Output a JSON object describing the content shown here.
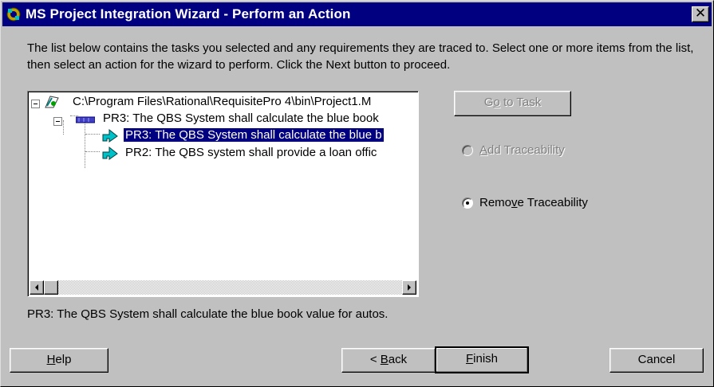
{
  "window": {
    "title": "MS Project Integration Wizard - Perform an Action",
    "close_symbol": "✕",
    "icon": "wizard-gear-icon"
  },
  "description": "The list below contains the tasks you selected and any requirements they are traced to. Select one or more items from the list, then select an action for the wizard to perform. Click the Next button to proceed.",
  "tree": {
    "root": {
      "label": "C:\\Program Files\\Rational\\RequisitePro 4\\bin\\Project1.M",
      "icon": "project-file-icon"
    },
    "task": {
      "label": "PR3: The QBS System shall calculate the blue book",
      "icon": "task-bar-icon"
    },
    "children": [
      {
        "label": "PR3: The QBS System shall calculate the blue b",
        "icon": "trace-arrow-icon",
        "selected": true
      },
      {
        "label": "PR2: The QBS system shall provide a loan offic",
        "icon": "trace-arrow-icon",
        "selected": false
      }
    ]
  },
  "selected_detail": "PR3: The QBS System shall calculate the blue book value for autos.",
  "actions": {
    "goto_task": {
      "pre": "G",
      "u": "o",
      "post": " to Task",
      "enabled": false
    },
    "add_trace": {
      "pre": "",
      "u": "A",
      "post": "dd Traceability",
      "enabled": false,
      "checked": false
    },
    "remove_trace": {
      "pre": "Remo",
      "u": "v",
      "post": "e Traceability",
      "enabled": true,
      "checked": true
    }
  },
  "buttons": {
    "help": {
      "pre": "",
      "u": "H",
      "post": "elp"
    },
    "back": {
      "pre": "< ",
      "u": "B",
      "post": "ack"
    },
    "finish": {
      "pre": "",
      "u": "F",
      "post": "inish"
    },
    "cancel": {
      "pre": "Cancel",
      "u": "",
      "post": ""
    }
  },
  "colors": {
    "titlebar": "#000080",
    "face": "#c0c0c0",
    "selection": "#000080",
    "trace_icon": "#00a8b0"
  }
}
